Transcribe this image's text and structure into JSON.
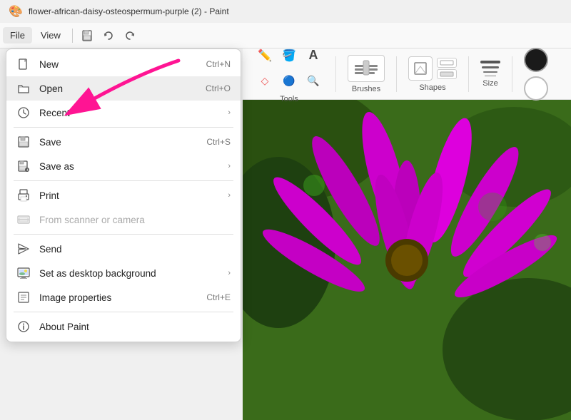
{
  "window": {
    "title": "flower-african-daisy-osteospermum-purple (2) - Paint",
    "icon": "🎨"
  },
  "menubar": {
    "file_label": "File",
    "view_label": "View",
    "save_icon": "💾",
    "undo_icon": "↩",
    "redo_icon": "↪"
  },
  "toolbar": {
    "tools_label": "Tools",
    "brushes_label": "Brushes",
    "shapes_label": "Shapes",
    "size_label": "Size"
  },
  "file_menu": {
    "items": [
      {
        "id": "new",
        "icon": "📄",
        "label": "New",
        "shortcut": "Ctrl+N",
        "arrow": false,
        "disabled": false
      },
      {
        "id": "open",
        "icon": "📁",
        "label": "Open",
        "shortcut": "Ctrl+O",
        "arrow": false,
        "disabled": false,
        "highlighted": true
      },
      {
        "id": "recent",
        "icon": "🕐",
        "label": "Recent",
        "shortcut": "",
        "arrow": true,
        "disabled": false
      },
      {
        "id": "save",
        "icon": "💾",
        "label": "Save",
        "shortcut": "Ctrl+S",
        "arrow": false,
        "disabled": false
      },
      {
        "id": "save-as",
        "icon": "💾",
        "label": "Save as",
        "shortcut": "",
        "arrow": true,
        "disabled": false
      },
      {
        "id": "print",
        "icon": "🖨️",
        "label": "Print",
        "shortcut": "",
        "arrow": true,
        "disabled": false
      },
      {
        "id": "scanner",
        "icon": "🖼️",
        "label": "From scanner or camera",
        "shortcut": "",
        "arrow": false,
        "disabled": true
      },
      {
        "id": "send",
        "icon": "↗️",
        "label": "Send",
        "shortcut": "",
        "arrow": false,
        "disabled": false
      },
      {
        "id": "desktop-bg",
        "icon": "🖥️",
        "label": "Set as desktop background",
        "shortcut": "",
        "arrow": true,
        "disabled": false
      },
      {
        "id": "image-props",
        "icon": "📋",
        "label": "Image properties",
        "shortcut": "Ctrl+E",
        "arrow": false,
        "disabled": false
      },
      {
        "id": "about",
        "icon": "⚙️",
        "label": "About Paint",
        "shortcut": "",
        "arrow": false,
        "disabled": false
      }
    ]
  }
}
